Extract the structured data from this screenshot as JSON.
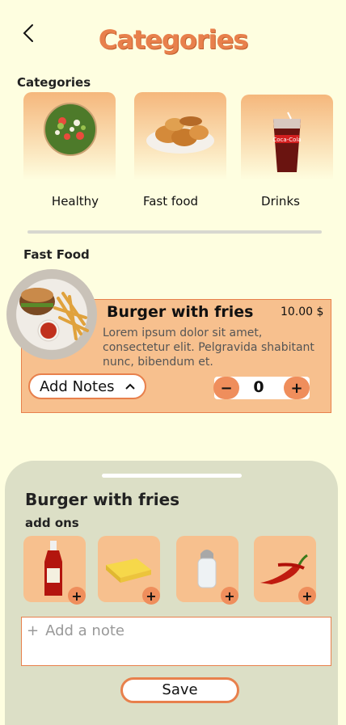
{
  "header": {
    "title": "Categories",
    "back_icon": "chevron-left-icon"
  },
  "categories": {
    "label": "Categories",
    "items": [
      {
        "label": "Healthy",
        "icon": "salad-bowl-icon"
      },
      {
        "label": "Fast food",
        "icon": "fried-chicken-icon"
      },
      {
        "label": "Drinks",
        "icon": "cola-glass-icon"
      }
    ]
  },
  "fast_food": {
    "label": "Fast Food",
    "item": {
      "name": "Burger with fries",
      "price": "10.00 $",
      "description": "Lorem ipsum dolor sit amet, consectetur elit. Pelgravida shabitant nunc, bibendum et.",
      "notes_label": "Add Notes",
      "quantity": "0",
      "minus": "−",
      "plus": "+"
    }
  },
  "sheet": {
    "title": "Burger with fries",
    "addons_label": "add ons",
    "addons": [
      {
        "icon": "ketchup-icon",
        "plus": "+"
      },
      {
        "icon": "butter-icon",
        "plus": "+"
      },
      {
        "icon": "salt-shaker-icon",
        "plus": "+"
      },
      {
        "icon": "chili-pepper-icon",
        "plus": "+"
      }
    ],
    "note_placeholder": "Add a note",
    "note_plus": "+",
    "save_label": "Save"
  },
  "colors": {
    "accent": "#e8804c",
    "background": "#fefee0",
    "card": "#f7c08e",
    "sheet": "#dcdfc6"
  }
}
